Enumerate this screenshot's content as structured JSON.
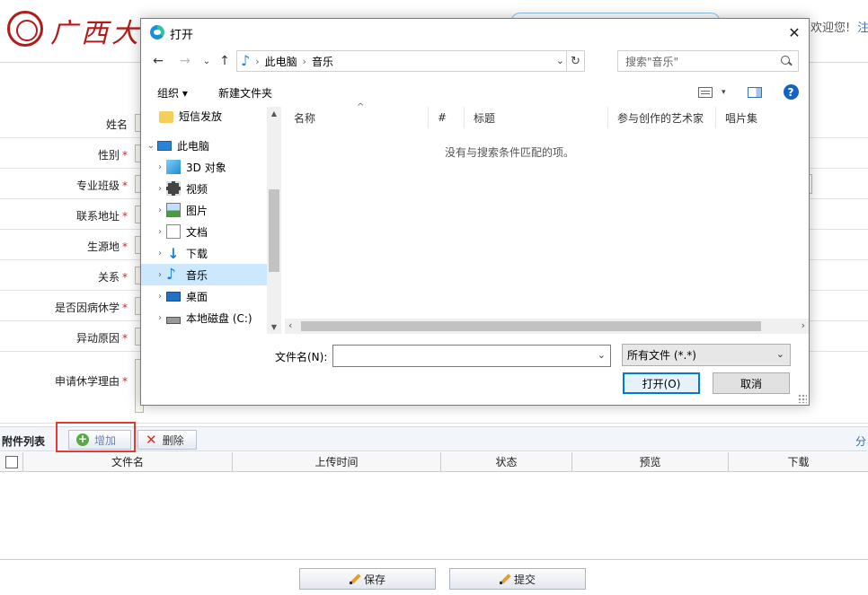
{
  "site": {
    "logo_text": "广西大学",
    "welcome": "欢迎您!",
    "logout": "注销"
  },
  "form": {
    "fields": [
      {
        "label": "姓名",
        "required": ""
      },
      {
        "label": "性别",
        "required": "*"
      },
      {
        "label": "专业班级",
        "required": "*"
      },
      {
        "label": "联系地址",
        "required": "*"
      },
      {
        "label": "生源地",
        "required": "*"
      },
      {
        "label": "关系",
        "required": "*"
      },
      {
        "label": "是否因病休学",
        "required": "*"
      },
      {
        "label": "异动原因",
        "required": "*"
      },
      {
        "label": "申请休学理由",
        "required": "*"
      }
    ]
  },
  "attachments": {
    "title": "附件列表",
    "add_label": "增加",
    "delete_label": "删除",
    "more": "分",
    "columns": [
      "文件名",
      "上传时间",
      "状态",
      "预览",
      "下载"
    ]
  },
  "actions": {
    "save_label": "保存",
    "submit_label": "提交"
  },
  "dialog": {
    "title": "打开",
    "close_glyph": "✕",
    "breadcrumb": [
      "此电脑",
      "音乐"
    ],
    "search_placeholder": "搜索\"音乐\"",
    "toolbar": {
      "organize_label": "组织 ▾",
      "new_folder_label": "新建文件夹"
    },
    "tree": [
      {
        "label": "短信发放",
        "icon": "folder-icon",
        "chevron": ""
      },
      {
        "label": "此电脑",
        "icon": "computer-icon",
        "chevron": "⌄"
      },
      {
        "label": "3D 对象",
        "icon": "3d-objects-icon",
        "chevron": "›"
      },
      {
        "label": "视频",
        "icon": "video-icon",
        "chevron": "›"
      },
      {
        "label": "图片",
        "icon": "pictures-icon",
        "chevron": "›"
      },
      {
        "label": "文档",
        "icon": "documents-icon",
        "chevron": "›"
      },
      {
        "label": "下载",
        "icon": "downloads-icon",
        "chevron": "›"
      },
      {
        "label": "音乐",
        "icon": "music-icon",
        "chevron": "›",
        "selected": true
      },
      {
        "label": "桌面",
        "icon": "desktop-icon",
        "chevron": "›"
      },
      {
        "label": "本地磁盘 (C:)",
        "icon": "disk-icon",
        "chevron": "›"
      }
    ],
    "columns": [
      "名称",
      "#",
      "标题",
      "参与创作的艺术家",
      "唱片集"
    ],
    "empty_message": "没有与搜索条件匹配的项。",
    "filename_label": "文件名(N):",
    "filename_value": "",
    "file_type": "所有文件 (*.*)",
    "open_label": "打开(O)",
    "cancel_label": "取消"
  },
  "colors": {
    "brand_red": "#b31b1b",
    "highlight": "#e53935",
    "selection": "#cce8ff",
    "primary_border": "#0078d7"
  }
}
